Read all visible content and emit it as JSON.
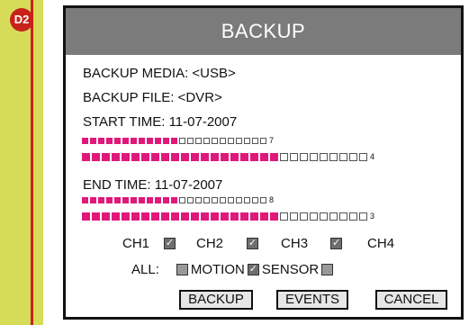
{
  "sidebar": {
    "badge": "D2",
    "color": "#d6dc58",
    "accent": "#c8221a"
  },
  "dialog": {
    "title": "BACKUP",
    "media_line": "BACKUP MEDIA: <USB>",
    "file_line": "BACKUP FILE: <DVR>",
    "start_line": "START TIME: 11-07-2007",
    "end_line": "END TIME: 11-07-2007",
    "bars": {
      "start_date": {
        "filled": 12,
        "total": 23,
        "label": "7"
      },
      "start_time": {
        "filled": 20,
        "total": 29,
        "label": "4"
      },
      "end_date": {
        "filled": 12,
        "total": 23,
        "label": "8"
      },
      "end_time": {
        "filled": 20,
        "total": 29,
        "label": "3"
      }
    },
    "channels": [
      {
        "label": "CH1",
        "checked": true
      },
      {
        "label": "CH2",
        "checked": true
      },
      {
        "label": "CH3",
        "checked": true
      },
      {
        "label": "CH4",
        "checked": false
      }
    ],
    "all_label": "ALL:",
    "motion_label": "MOTION",
    "sensor_label": "SENSOR",
    "all_checked": false,
    "motion_checked": true,
    "sensor_checked": false,
    "buttons": {
      "backup": "BACKUP",
      "events": "EVENTS",
      "cancel": "CANCEL"
    },
    "bar_fill_color": "#e0187b"
  }
}
